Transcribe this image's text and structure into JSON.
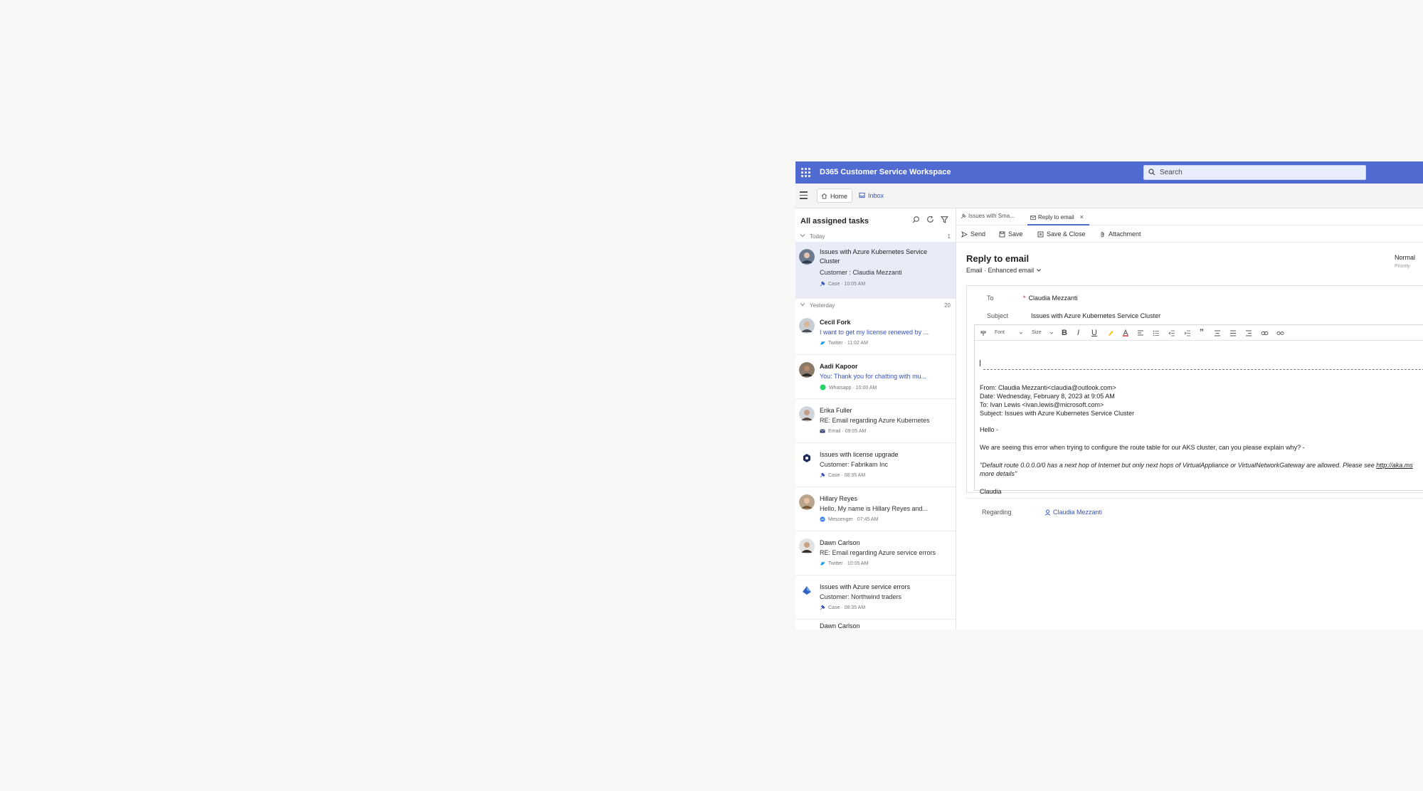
{
  "app": {
    "title": "D365 Customer Service Workspace",
    "search_placeholder": "Search"
  },
  "nav": {
    "home_label": "Home",
    "inbox_label": "Inbox"
  },
  "tasks": {
    "title": "All assigned tasks",
    "groups": [
      {
        "label": "Today",
        "count": "1"
      },
      {
        "label": "Yesterday",
        "count": "20"
      }
    ],
    "items": [
      {
        "title": "Issues with Azure Kubernetes Service Cluster",
        "subtitle": "Customer : Claudia Mezzanti",
        "channel": "Case",
        "time": "10:05 AM",
        "icon": "case-icon"
      },
      {
        "title": "Cecil Fork",
        "subtitle": "I want to get my license renewed by ...",
        "channel": "Twitter",
        "time": "11:02 AM",
        "icon": "twitter-icon"
      },
      {
        "title": "Aadi Kapoor",
        "subtitle": "You: Thank you for chatting with mu...",
        "channel": "Whatsapp",
        "time": "10:00 AM",
        "icon": "whatsapp-icon"
      },
      {
        "title": "Erika Fuller",
        "subtitle": "RE: Email regarding Azure Kubernetes",
        "channel": "Email",
        "time": "09:05 AM",
        "icon": "email-icon"
      },
      {
        "title": "Issues with license upgrade",
        "subtitle": "Customer: Fabrikam Inc",
        "channel": "Case",
        "time": "08:35 AM",
        "icon": "case-icon"
      },
      {
        "title": "Hillary Reyes",
        "subtitle": "Hello, My name is Hillary Reyes and...",
        "channel": "Messenger",
        "time": "07:45 AM",
        "icon": "messenger-icon"
      },
      {
        "title": "Dawn Carlson",
        "subtitle": "RE: Email regarding Azure service errors",
        "channel": "Twitter",
        "time": "10:05 AM",
        "icon": "twitter-icon"
      },
      {
        "title": "Issues with Azure service errors",
        "subtitle": "Customer: Northwind traders",
        "channel": "Case",
        "time": "08:35 AM",
        "icon": "case-icon"
      },
      {
        "title": "Dawn Carlson",
        "subtitle": "",
        "channel": "",
        "time": "",
        "icon": ""
      }
    ]
  },
  "session_tabs": [
    {
      "label": "Issues with Sma..."
    },
    {
      "label": "Reply to email",
      "close": "×"
    }
  ],
  "commands": {
    "send": "Send",
    "save": "Save",
    "save_close": "Save & Close",
    "attachment": "Attachment"
  },
  "form": {
    "title": "Reply to email",
    "entity": "Email",
    "separator": "·",
    "form_name": "Enhanced email",
    "priority_value": "Normal",
    "priority_label": "Priority",
    "to_label": "To",
    "required_marker": "*",
    "to_value": "Claudia Mezzanti",
    "subject_label": "Subject",
    "subject_value": "Issues with Azure Kubernetes Service Cluster",
    "toolbar": {
      "font": "Font",
      "size": "Size"
    },
    "quoted": {
      "from": "From: Claudia Mezzanti<claudia@outlook.com>",
      "date": "Date: Wednesday, February 8, 2023 at 9:05 AM",
      "to": "To: Ivan Lewis <ivan.lewis@microsoft.com>",
      "subject": "Subject: Issues with Azure Kubernetes Service Cluster"
    },
    "greeting": "Hello -",
    "body": "We are seeing this error when trying to configure the route table for our AKS cluster, can you please explain why? -",
    "error_line1": "\"Default route 0.0.0.0/0 has a next hop of Internet but only next hops of VirtualAppliance or VirtualNetworkGateway are allowed. Please see ",
    "error_link": "http://aka.ms",
    "error_line2": "more details\"",
    "signature": "Claudia",
    "regarding_label": "Regarding",
    "regarding_value": "Claudia Mezzanti"
  },
  "colors": {
    "header": "#4f6bd1",
    "selected_row": "#e8ecf8",
    "link": "#3652c0"
  }
}
